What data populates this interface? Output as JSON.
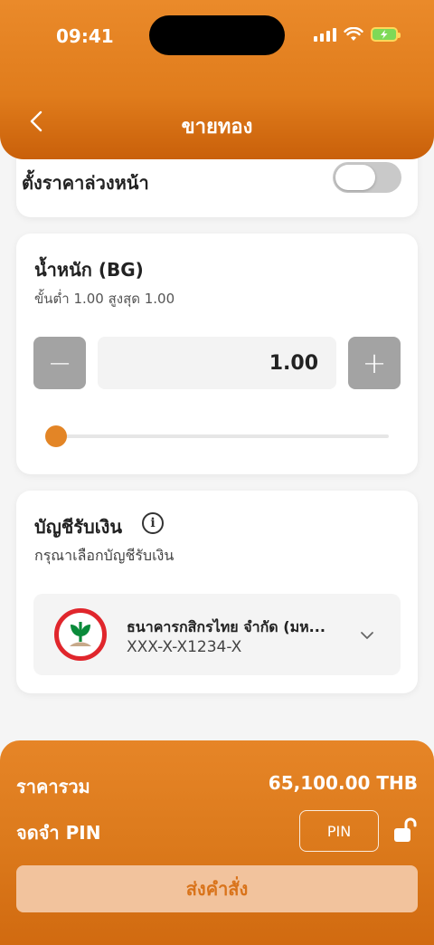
{
  "status_bar": {
    "time": "09:41"
  },
  "header": {
    "title": "ขายทอง"
  },
  "preset": {
    "label": "ตั้งราคาล่วงหน้า",
    "toggle_on": false
  },
  "weight": {
    "title": "น้ำหนัก (BG)",
    "range_text": "ขั้นต่ำ 1.00  สูงสุด 1.00",
    "value": "1.00",
    "minus_symbol": "−",
    "plus_symbol": "+",
    "slider_fraction": 0.0
  },
  "account": {
    "title": "บัญชีรับเงิน",
    "info_symbol": "i",
    "subtitle": "กรุณาเลือกบัญชีรับเงิน",
    "bank_name": "ธนาคารกสิกรไทย จำกัด (มห...",
    "account_number": "XXX-X-X1234-X",
    "bank_logo_icon": "kasikorn-bank-logo",
    "bank_color": "#e0262c"
  },
  "summary": {
    "total_label": "ราคารวม",
    "total_value": "65,100.00 THB",
    "pin_label": "จดจำ PIN",
    "pin_button": "PIN",
    "submit_label": "ส่งคำสั่ง"
  },
  "colors": {
    "primary_orange": "#e38526",
    "submit_bg": "#f2c39d",
    "stepper_gray": "#a3a3a3"
  }
}
